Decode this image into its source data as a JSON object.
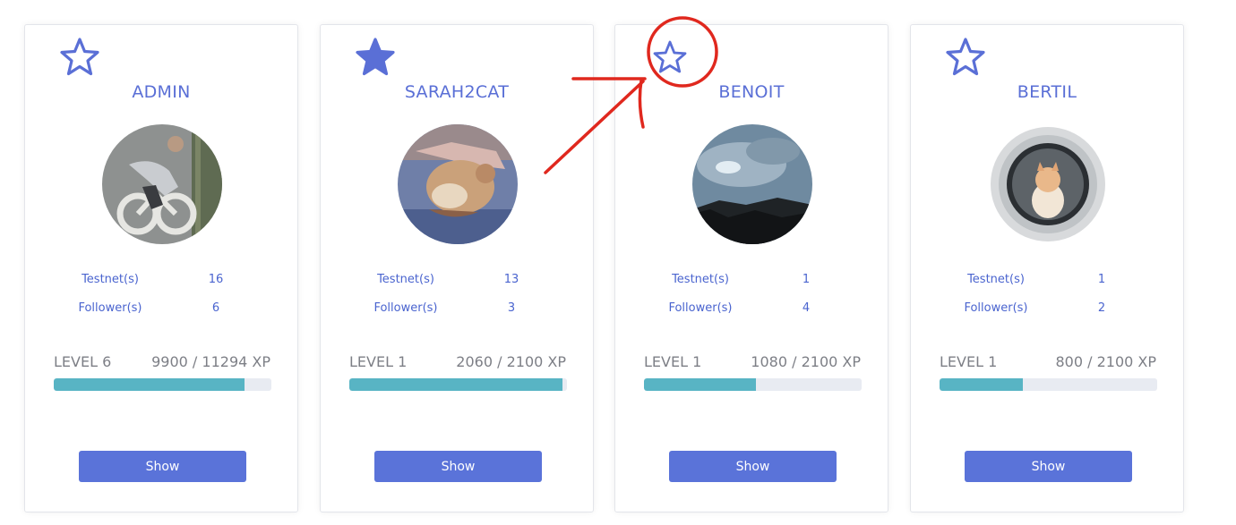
{
  "labels": {
    "testnets": "Testnet(s)",
    "followers": "Follower(s)"
  },
  "colors": {
    "accent": "#5a6fd6",
    "button": "#5a73d9",
    "progress": "#58b4c4",
    "progress_track": "#e8ebf2",
    "annotation": "#e0281e"
  },
  "cards": [
    {
      "favorite": false,
      "name": "ADMIN",
      "avatar": "man-lying-on-bicycle-road-marking-photo",
      "testnets": "16",
      "followers": "6",
      "level": "LEVEL 6",
      "xp": "9900 / 11294 XP",
      "progress": 0.877,
      "button": "Show"
    },
    {
      "favorite": true,
      "name": "SARAH2CAT",
      "avatar": "cat-lying-on-bed-photo",
      "testnets": "13",
      "followers": "3",
      "level": "LEVEL 1",
      "xp": "2060 / 2100 XP",
      "progress": 0.981,
      "button": "Show"
    },
    {
      "favorite": false,
      "name": "BENOIT",
      "avatar": "cloudy-sky-over-forest-photo",
      "testnets": "1",
      "followers": "4",
      "level": "LEVEL 1",
      "xp": "1080 / 2100 XP",
      "progress": 0.514,
      "button": "Show"
    },
    {
      "favorite": false,
      "name": "BERTIL",
      "avatar": "kitten-in-washing-machine-photo",
      "testnets": "1",
      "followers": "2",
      "level": "LEVEL 1",
      "xp": "800 / 2100 XP",
      "progress": 0.381,
      "button": "Show"
    }
  ]
}
